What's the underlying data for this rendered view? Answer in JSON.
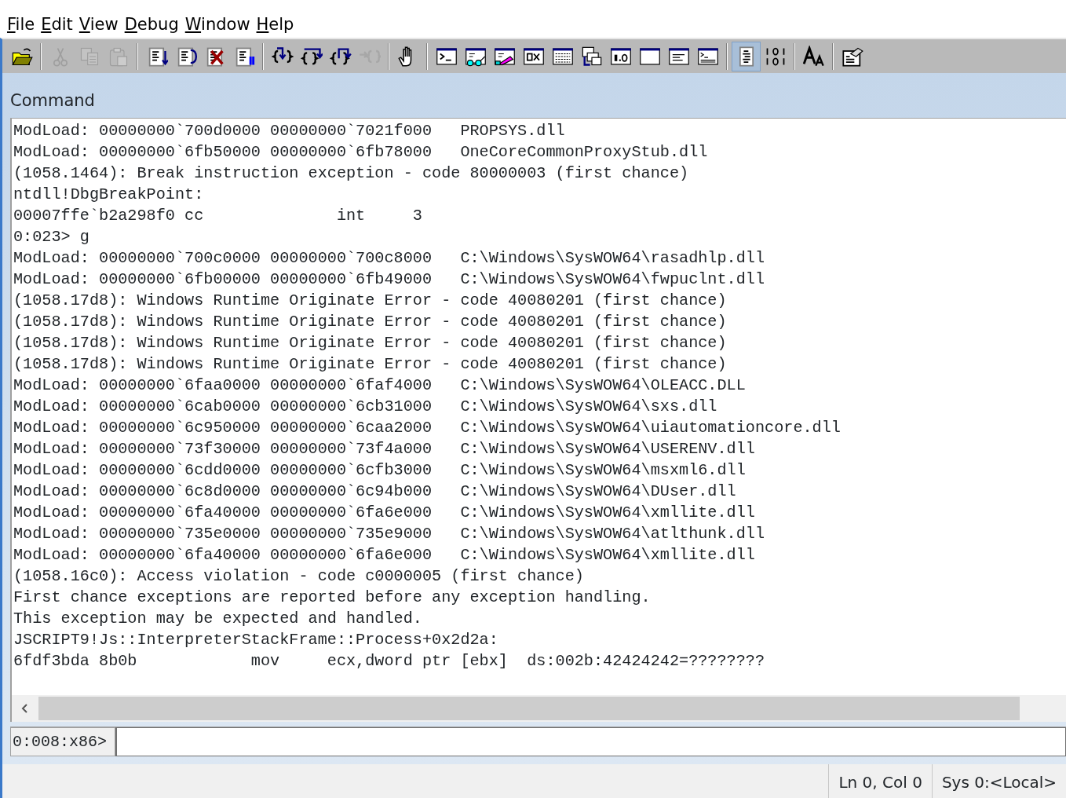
{
  "menu": [
    "File",
    "Edit",
    "View",
    "Debug",
    "Window",
    "Help"
  ],
  "toolbar": [
    [
      {
        "kind": "open",
        "disabled": false,
        "selected": false
      }
    ],
    [
      {
        "kind": "cut",
        "disabled": true,
        "selected": false
      },
      {
        "kind": "copy",
        "disabled": true,
        "selected": false
      },
      {
        "kind": "paste",
        "disabled": true,
        "selected": false
      }
    ],
    [
      {
        "kind": "go",
        "disabled": false,
        "selected": false
      },
      {
        "kind": "restart",
        "disabled": false,
        "selected": false
      },
      {
        "kind": "stop",
        "disabled": false,
        "selected": false
      },
      {
        "kind": "break",
        "disabled": false,
        "selected": false
      }
    ],
    [
      {
        "kind": "stepin",
        "disabled": false,
        "selected": false
      },
      {
        "kind": "stepover",
        "disabled": false,
        "selected": false
      },
      {
        "kind": "stepout",
        "disabled": false,
        "selected": false
      },
      {
        "kind": "runcursor",
        "disabled": true,
        "selected": false
      }
    ],
    [
      {
        "kind": "hand",
        "disabled": false,
        "selected": false
      }
    ],
    [
      {
        "kind": "command",
        "disabled": false,
        "selected": false
      },
      {
        "kind": "watch",
        "disabled": false,
        "selected": false
      },
      {
        "kind": "locals",
        "disabled": false,
        "selected": false
      },
      {
        "kind": "registers",
        "disabled": false,
        "selected": false
      },
      {
        "kind": "memory",
        "disabled": false,
        "selected": false
      },
      {
        "kind": "callstack",
        "disabled": false,
        "selected": false
      },
      {
        "kind": "disasm",
        "disabled": false,
        "selected": false
      },
      {
        "kind": "scratch",
        "disabled": false,
        "selected": false
      },
      {
        "kind": "processes",
        "disabled": false,
        "selected": false
      },
      {
        "kind": "commandlines",
        "disabled": false,
        "selected": false
      }
    ],
    [
      {
        "kind": "sourcemode",
        "disabled": false,
        "selected": true
      },
      {
        "kind": "hex",
        "disabled": false,
        "selected": false
      }
    ],
    [
      {
        "kind": "font",
        "disabled": false,
        "selected": false
      }
    ],
    [
      {
        "kind": "options",
        "disabled": false,
        "selected": false
      }
    ]
  ],
  "panel": {
    "title": "Command",
    "lines": [
      "ModLoad: 00000000`700d0000 00000000`7021f000   PROPSYS.dll",
      "ModLoad: 00000000`6fb50000 00000000`6fb78000   OneCoreCommonProxyStub.dll",
      "(1058.1464): Break instruction exception - code 80000003 (first chance)",
      "ntdll!DbgBreakPoint:",
      "00007ffe`b2a298f0 cc              int     3",
      "0:023> g",
      "ModLoad: 00000000`700c0000 00000000`700c8000   C:\\Windows\\SysWOW64\\rasadhlp.dll",
      "ModLoad: 00000000`6fb00000 00000000`6fb49000   C:\\Windows\\SysWOW64\\fwpuclnt.dll",
      "(1058.17d8): Windows Runtime Originate Error - code 40080201 (first chance)",
      "(1058.17d8): Windows Runtime Originate Error - code 40080201 (first chance)",
      "(1058.17d8): Windows Runtime Originate Error - code 40080201 (first chance)",
      "(1058.17d8): Windows Runtime Originate Error - code 40080201 (first chance)",
      "ModLoad: 00000000`6faa0000 00000000`6faf4000   C:\\Windows\\SysWOW64\\OLEACC.DLL",
      "ModLoad: 00000000`6cab0000 00000000`6cb31000   C:\\Windows\\SysWOW64\\sxs.dll",
      "ModLoad: 00000000`6c950000 00000000`6caa2000   C:\\Windows\\SysWOW64\\uiautomationcore.dll",
      "ModLoad: 00000000`73f30000 00000000`73f4a000   C:\\Windows\\SysWOW64\\USERENV.dll",
      "ModLoad: 00000000`6cdd0000 00000000`6cfb3000   C:\\Windows\\SysWOW64\\msxml6.dll",
      "ModLoad: 00000000`6c8d0000 00000000`6c94b000   C:\\Windows\\SysWOW64\\DUser.dll",
      "ModLoad: 00000000`6fa40000 00000000`6fa6e000   C:\\Windows\\SysWOW64\\xmllite.dll",
      "ModLoad: 00000000`735e0000 00000000`735e9000   C:\\Windows\\SysWOW64\\atlthunk.dll",
      "ModLoad: 00000000`6fa40000 00000000`6fa6e000   C:\\Windows\\SysWOW64\\xmllite.dll",
      "(1058.16c0): Access violation - code c0000005 (first chance)",
      "First chance exceptions are reported before any exception handling.",
      "This exception may be expected and handled.",
      "JSCRIPT9!Js::InterpreterStackFrame::Process+0x2d2a:",
      "6fdf3bda 8b0b            mov     ecx,dword ptr [ebx]  ds:002b:42424242=????????"
    ],
    "prompt": "0:008:x86>"
  },
  "status_bar": [
    "Ln 0, Col 0",
    "Sys 0:<Local>"
  ]
}
